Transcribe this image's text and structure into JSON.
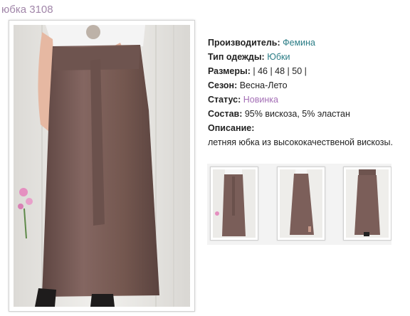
{
  "product": {
    "title": "юбка 3108"
  },
  "details": {
    "manufacturer": {
      "label": "Производитель:",
      "value": "Фемина"
    },
    "clothing_type": {
      "label": "Тип одежды:",
      "value": "Юбки"
    },
    "sizes": {
      "label": "Размеры:",
      "value": "| 46 | 48 | 50 |"
    },
    "season": {
      "label": "Сезон:",
      "value": "Весна-Лето"
    },
    "status": {
      "label": "Статус:",
      "value": "Новинка"
    },
    "composition": {
      "label": "Состав:",
      "value": "95% вискоза, 5% эластан"
    },
    "description": {
      "label": "Описание:",
      "value": "летняя юбка из высококачественой вискозы."
    }
  },
  "colors": {
    "title": "#a186a9",
    "link_teal": "#2b7d86",
    "link_violet": "#a46fb6",
    "skirt": "#7a5e59"
  },
  "thumbnails": [
    {
      "name": "front-view"
    },
    {
      "name": "side-view"
    },
    {
      "name": "back-view"
    }
  ]
}
